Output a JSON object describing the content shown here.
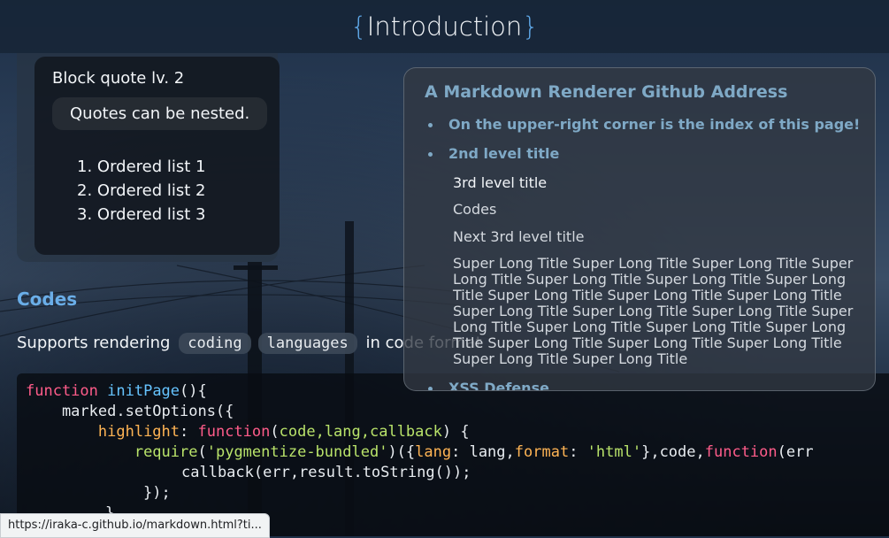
{
  "header": {
    "brace_open": "{",
    "title": "Introduction",
    "brace_close": "}"
  },
  "quote": {
    "title": "Block quote lv. 2",
    "nested": "Quotes can be nested.",
    "list": [
      "1. Ordered list 1",
      "2. Ordered list 2",
      "3. Ordered list 3"
    ]
  },
  "codes_section": {
    "title": "Codes",
    "support_prefix": "Supports rendering",
    "inline_code_1": "coding",
    "inline_code_2": "languages",
    "support_suffix": "in code format"
  },
  "code": {
    "l1_kw": "function",
    "l1_fn": "initPage",
    "l1_rest": "(){",
    "l2": "    marked.setOptions({",
    "l3_prop": "highlight",
    "l3_colon": ": ",
    "l3_kw": "function",
    "l3_open": "(",
    "l3_params": "code,lang,callback",
    "l3_close": ") {",
    "l4_fn": "require",
    "l4_open": "(",
    "l4_str": "'pygmentize-bundled'",
    "l4_mid": ")({",
    "l4_prop1": "lang",
    "l4_rest1": ": lang,",
    "l4_prop2": "format",
    "l4_colon2": ": ",
    "l4_str2": "'html'",
    "l4_rest2": "},code,",
    "l4_kw": "function",
    "l4_tail": "(err",
    "l5": "callback(err,result.toString());",
    "l6": "});",
    "l7": "}"
  },
  "toc": {
    "title": "A Markdown Renderer Github Address",
    "item1": "On the upper-right corner is the index of this page!",
    "item2": "2nd level title",
    "sub1": "3rd level title",
    "sub2": "Codes",
    "sub3": "Next 3rd level title",
    "long": "Super Long Title Super Long Title Super Long Title Super Long Title Super Long Title Super Long Title Super Long Title Super Long Title Super Long Title Super Long Title Super Long Title Super Long Title Super Long Title Super Long Title Super Long Title Super Long Title Super Long Title Super Long Title Super Long Title Super Long Title Super Long Title Super Long Title",
    "item3": "XSS Defense"
  },
  "status_bar": {
    "url": "https://iraka-c.github.io/markdown.html?ti..."
  }
}
